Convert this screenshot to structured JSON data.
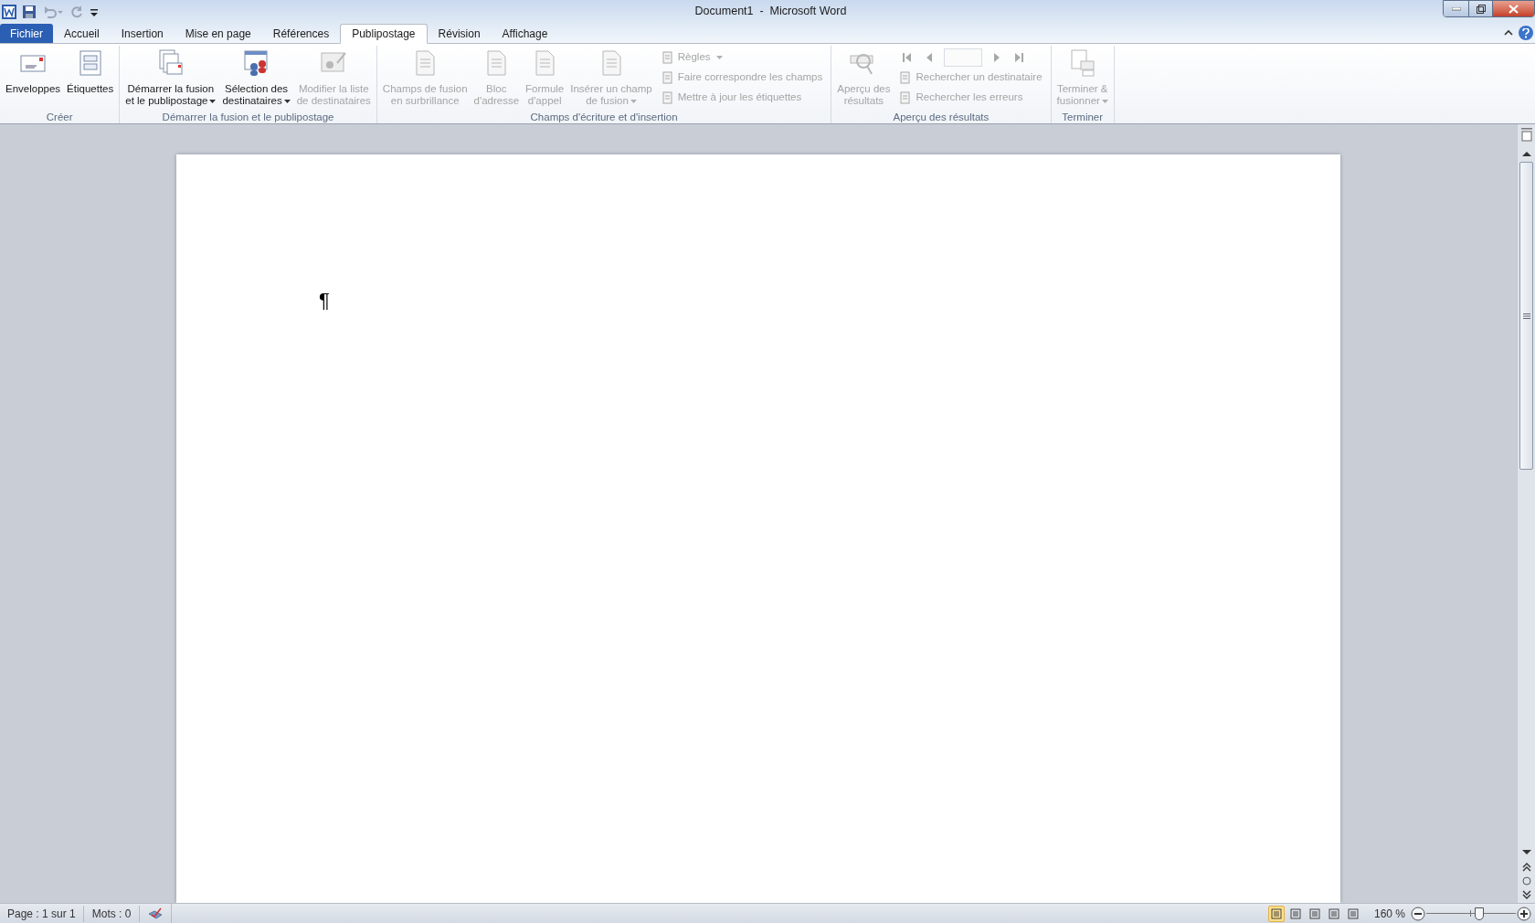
{
  "window": {
    "title": "Document1  -  Microsoft Word"
  },
  "tabs": [
    {
      "label": "Fichier",
      "kind": "file",
      "selected": false
    },
    {
      "label": "Accueil",
      "kind": "tab",
      "selected": false
    },
    {
      "label": "Insertion",
      "kind": "tab",
      "selected": false
    },
    {
      "label": "Mise en page",
      "kind": "tab",
      "selected": false
    },
    {
      "label": "Références",
      "kind": "tab",
      "selected": false
    },
    {
      "label": "Publipostage",
      "kind": "tab",
      "selected": true
    },
    {
      "label": "Révision",
      "kind": "tab",
      "selected": false
    },
    {
      "label": "Affichage",
      "kind": "tab",
      "selected": false
    }
  ],
  "ribbon": {
    "groups": [
      {
        "label": "Créer",
        "items": [
          {
            "kind": "large",
            "lines": [
              "Enveloppes"
            ],
            "disabled": false,
            "dropdown": false
          },
          {
            "kind": "large",
            "lines": [
              "Étiquettes"
            ],
            "disabled": false,
            "dropdown": false
          }
        ]
      },
      {
        "label": "Démarrer la fusion et le publipostage",
        "items": [
          {
            "kind": "large",
            "lines": [
              "Démarrer la fusion",
              "et le publipostage"
            ],
            "disabled": false,
            "dropdown": true
          },
          {
            "kind": "large",
            "lines": [
              "Sélection des",
              "destinataires"
            ],
            "disabled": false,
            "dropdown": true
          },
          {
            "kind": "large",
            "lines": [
              "Modifier la liste",
              "de destinataires"
            ],
            "disabled": true,
            "dropdown": false
          }
        ]
      },
      {
        "label": "Champs d'écriture et d'insertion",
        "items": [
          {
            "kind": "large",
            "lines": [
              "Champs de fusion",
              "en surbrillance"
            ],
            "disabled": true,
            "dropdown": false
          },
          {
            "kind": "large",
            "lines": [
              "Bloc",
              "d'adresse"
            ],
            "disabled": true,
            "dropdown": false
          },
          {
            "kind": "large",
            "lines": [
              "Formule",
              "d'appel"
            ],
            "disabled": true,
            "dropdown": false
          },
          {
            "kind": "large",
            "lines": [
              "Insérer un champ",
              "de fusion"
            ],
            "disabled": true,
            "dropdown": true
          },
          {
            "kind": "small",
            "lines": [
              "Règles"
            ],
            "disabled": true,
            "dropdown": true
          },
          {
            "kind": "small",
            "lines": [
              "Faire correspondre les champs"
            ],
            "disabled": true,
            "dropdown": false
          },
          {
            "kind": "small",
            "lines": [
              "Mettre à jour les étiquettes"
            ],
            "disabled": true,
            "dropdown": false
          }
        ]
      },
      {
        "label": "Aperçu des résultats",
        "items": [
          {
            "kind": "large",
            "lines": [
              "Aperçu des",
              "résultats"
            ],
            "disabled": true,
            "dropdown": false
          },
          {
            "kind": "nav",
            "disabled": true
          },
          {
            "kind": "small",
            "lines": [
              "Rechercher un destinataire"
            ],
            "disabled": true,
            "dropdown": false
          },
          {
            "kind": "small",
            "lines": [
              "Rechercher les erreurs"
            ],
            "disabled": true,
            "dropdown": false
          }
        ]
      },
      {
        "label": "Terminer",
        "items": [
          {
            "kind": "large",
            "lines": [
              "Terminer &",
              "fusionner"
            ],
            "disabled": true,
            "dropdown": true
          }
        ]
      }
    ]
  },
  "document": {
    "paragraph_mark": "¶"
  },
  "status_bar": {
    "page": "Page : 1 sur 1",
    "words": "Mots : 0",
    "views": [
      {
        "selected": true
      },
      {
        "selected": false
      },
      {
        "selected": false
      },
      {
        "selected": false
      },
      {
        "selected": false
      }
    ],
    "zoom": "160 %",
    "zoom_slider": {
      "level": 0.6
    }
  }
}
